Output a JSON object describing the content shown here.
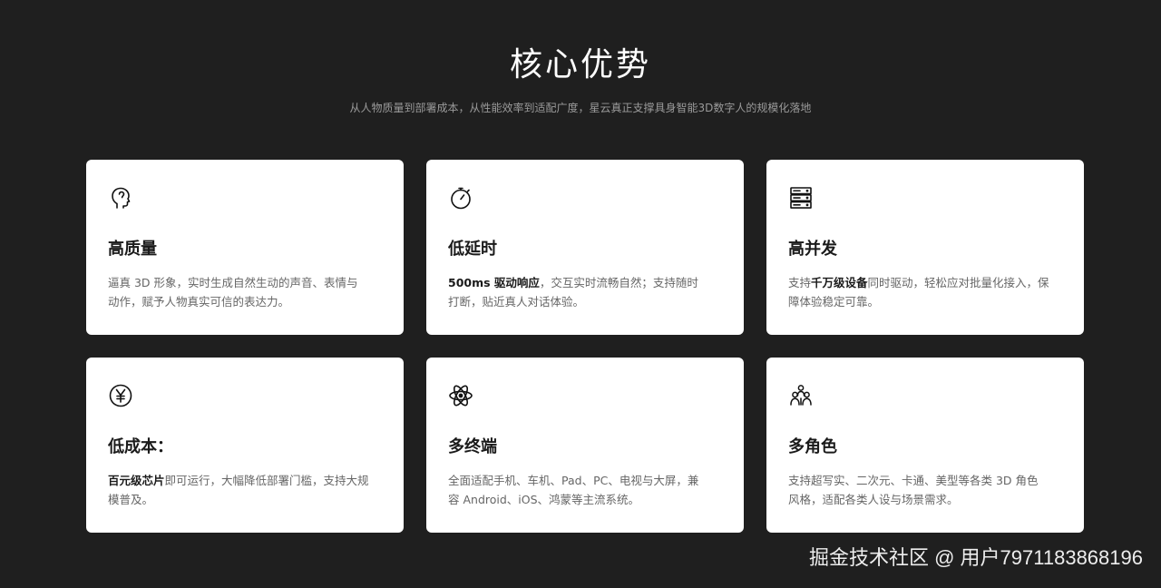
{
  "header": {
    "title": "核心优势",
    "subtitle": "从人物质量到部署成本，从性能效率到适配广度，星云真正支撑具身智能3D数字人的规模化落地"
  },
  "cards": [
    {
      "icon": "head-profile-icon",
      "title": "高质量",
      "desc_bold": "",
      "desc": "逼真 3D 形象，实时生成自然生动的声音、表情与动作，赋予人物真实可信的表达力。"
    },
    {
      "icon": "stopwatch-icon",
      "title": "低延时",
      "desc_bold": "500ms 驱动响应",
      "desc": "，交互实时流畅自然；支持随时打断，贴近真人对话体验。"
    },
    {
      "icon": "server-stack-icon",
      "title": "高并发",
      "desc_pre": "支持",
      "desc_bold": "千万级设备",
      "desc": "同时驱动，轻松应对批量化接入，保障体验稳定可靠。"
    },
    {
      "icon": "yen-coin-icon",
      "title": "低成本：",
      "desc_bold": "百元级芯片",
      "desc": "即可运行，大幅降低部署门槛，支持大规模普及。"
    },
    {
      "icon": "atom-icon",
      "title": "多终端",
      "desc_bold": "",
      "desc": "全面适配手机、车机、Pad、PC、电视与大屏，兼容 Android、iOS、鸿蒙等主流系统。"
    },
    {
      "icon": "people-group-icon",
      "title": "多角色",
      "desc_bold": "",
      "desc": "支持超写实、二次元、卡通、美型等各类 3D 角色风格，适配各类人设与场景需求。"
    }
  ],
  "watermark": "掘金技术社区 @ 用户7971183868196"
}
